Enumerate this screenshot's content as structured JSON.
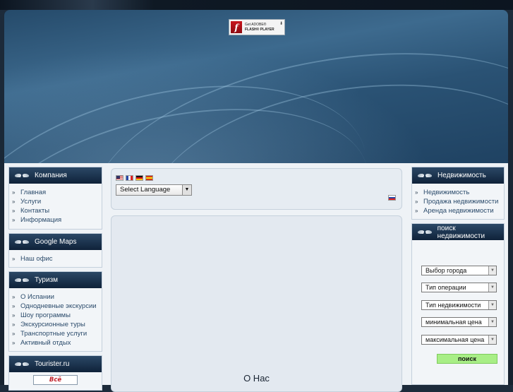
{
  "flash": {
    "get": "Get ADOBE®",
    "player": "FLASH® PLAYER"
  },
  "left": {
    "company": {
      "title": "Компания",
      "items": [
        "Главная",
        "Услуги",
        "Контакты",
        "Информация"
      ]
    },
    "maps": {
      "title": "Google Maps",
      "items": [
        "Наш офис"
      ]
    },
    "tourism": {
      "title": "Туризм",
      "items": [
        "О Испании",
        "Однодневные экскурсии",
        "Шоу программы",
        "Экскурсионные туры",
        "Транспортные услуги",
        "Активный отдых"
      ]
    },
    "tourister": {
      "title": "Tourister.ru",
      "button": "Всё"
    }
  },
  "center": {
    "language": {
      "selected": "Select Language"
    },
    "about_title": "О Нас"
  },
  "right": {
    "realty": {
      "title": "Недвижимость",
      "items": [
        "Недвижимость",
        "Продажа недвижимости",
        "Аренда недвижимости"
      ]
    },
    "search": {
      "title": "поиск недвижимости",
      "selects": [
        "Выбор города",
        "Тип операции",
        "Тип недвижимости",
        "минимальная цена",
        "максимальная цена"
      ],
      "button": "поиск"
    }
  },
  "colors": {
    "header_dark": "#0f2239",
    "button_green": "#a8ee86",
    "link": "#2b4b6b"
  }
}
